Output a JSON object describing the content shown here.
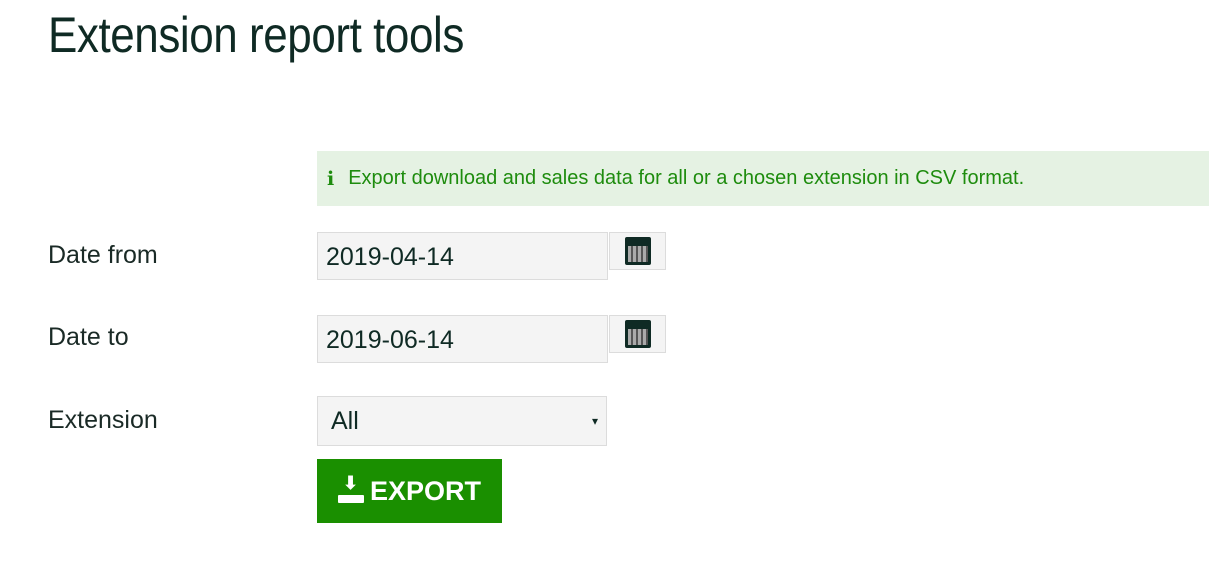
{
  "page": {
    "title": "Extension report tools"
  },
  "info": {
    "icon": "info-icon",
    "text": "Export download and sales data for all or a chosen extension in CSV format."
  },
  "form": {
    "date_from": {
      "label": "Date from",
      "value": "2019-04-14"
    },
    "date_to": {
      "label": "Date to",
      "value": "2019-06-14"
    },
    "extension": {
      "label": "Extension",
      "value": "All",
      "arrow": "▾"
    },
    "export": {
      "label": "EXPORT"
    }
  },
  "colors": {
    "accent": "#1a8f00",
    "info_bg": "#e5f2e3",
    "info_text": "#1e8c0e"
  }
}
